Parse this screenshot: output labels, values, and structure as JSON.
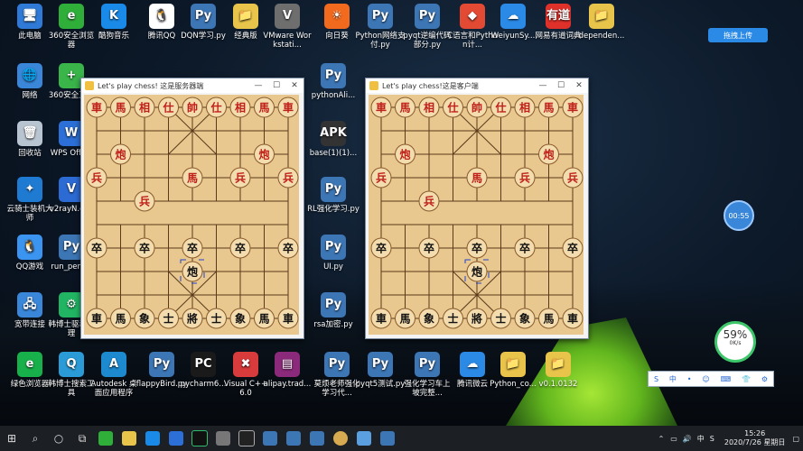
{
  "desktop_icons": [
    {
      "label": "此电脑",
      "color": "#2e7ad6",
      "glyph": "🖥"
    },
    {
      "label": "360安全浏览器",
      "color": "#2fae3a",
      "glyph": "e"
    },
    {
      "label": "酷狗音乐",
      "color": "#1a8ae8",
      "glyph": "K"
    },
    {
      "label": "腾讯QQ",
      "color": "#ffffff",
      "glyph": "🐧"
    },
    {
      "label": "DQN学习.py",
      "color": "#3d76b5",
      "glyph": "Py"
    },
    {
      "label": "经典版",
      "color": "#e8c44a",
      "glyph": "📁"
    },
    {
      "label": "VMware Workstati...",
      "color": "#6e6e6e",
      "glyph": "V"
    },
    {
      "label": "向日葵",
      "color": "#f26a1e",
      "glyph": "☀"
    },
    {
      "label": "Python网络支付.py",
      "color": "#3d76b5",
      "glyph": "Py"
    },
    {
      "label": "pyqt逆编代码部分.py",
      "color": "#3d76b5",
      "glyph": "Py"
    },
    {
      "label": "C语言和Python计...",
      "color": "#e24a34",
      "glyph": "◆"
    },
    {
      "label": "WeiyunSy...",
      "color": "#2a8ae6",
      "glyph": "☁"
    },
    {
      "label": "网易有道词典",
      "color": "#e0302a",
      "glyph": "有道"
    },
    {
      "label": "dependen...",
      "color": "#e8c44a",
      "glyph": "📁"
    },
    {
      "label": "网络",
      "color": "#3a86d8",
      "glyph": "🌐"
    },
    {
      "label": "360安全卫士",
      "color": "#39b54a",
      "glyph": "+"
    },
    {
      "label": "回收站",
      "color": "#b8c4d0",
      "glyph": "🗑"
    },
    {
      "label": "WPS Office",
      "color": "#2c6fd6",
      "glyph": "W"
    },
    {
      "label": "云骑士装机大师",
      "color": "#1f7ad2",
      "glyph": "✦"
    },
    {
      "label": "v2rayN.exe",
      "color": "#2d6bd4",
      "glyph": "V"
    },
    {
      "label": "QQ游戏",
      "color": "#3b95f0",
      "glyph": "🐧"
    },
    {
      "label": "run_pendu",
      "color": "#3d76b5",
      "glyph": "Py"
    },
    {
      "label": "宽带连接",
      "color": "#3a86d8",
      "glyph": "🖧"
    },
    {
      "label": "韩博士驱动助理",
      "color": "#21b563",
      "glyph": "⚙"
    },
    {
      "label": "绿色浏览器",
      "color": "#18b04a",
      "glyph": "e"
    },
    {
      "label": "韩博士搜索工具",
      "color": "#2a9bd6",
      "glyph": "Q"
    },
    {
      "label": "Autodesk 桌面应用程序",
      "color": "#1d8ad0",
      "glyph": "A"
    },
    {
      "label": "flappyBird.py",
      "color": "#3d76b5",
      "glyph": "Py"
    },
    {
      "label": "pycharm6...",
      "color": "#1a1a1a",
      "glyph": "PC"
    },
    {
      "label": "Visual C++ 6.0",
      "color": "#d83b3b",
      "glyph": "✖"
    },
    {
      "label": "alipay.trad...",
      "color": "#8b2a7a",
      "glyph": "▤"
    },
    {
      "label": "莫烦老师强化学习代...",
      "color": "#3d76b5",
      "glyph": "Py"
    },
    {
      "label": "pyqt5测试.py",
      "color": "#3d76b5",
      "glyph": "Py"
    },
    {
      "label": "强化学习车上坡完整...",
      "color": "#3d76b5",
      "glyph": "Py"
    },
    {
      "label": "腾讯微云",
      "color": "#2a8ae6",
      "glyph": "☁"
    },
    {
      "label": "Python_co...",
      "color": "#e8c44a",
      "glyph": "📁"
    },
    {
      "label": "v0.1.0132",
      "color": "#e8c44a",
      "glyph": "📁"
    },
    {
      "label": "pythonAli...",
      "color": "#3d76b5",
      "glyph": "Py"
    },
    {
      "label": "base(1)(1)...",
      "color": "#333333",
      "glyph": "APK"
    },
    {
      "label": "RL强化学习.py",
      "color": "#3d76b5",
      "glyph": "Py"
    },
    {
      "label": "UI.py",
      "color": "#3d76b5",
      "glyph": "Py"
    },
    {
      "label": "rsa加密.py",
      "color": "#3d76b5",
      "glyph": "Py"
    }
  ],
  "server_window": {
    "title": "Let's play chess! 这是服务器端",
    "min": "—",
    "max": "☐",
    "close": "✕"
  },
  "client_window": {
    "title": "Let's play chess!这是客户端",
    "min": "—",
    "max": "☐",
    "close": "✕"
  },
  "pieces_top": [
    "車",
    "馬",
    "相",
    "仕",
    "帥",
    "仕",
    "相",
    "馬",
    "車"
  ],
  "pieces_top_extra": [
    "炮",
    "炮",
    "兵",
    "馬",
    "兵",
    "兵",
    "兵"
  ],
  "pieces_bottom": [
    "車",
    "馬",
    "象",
    "士",
    "將",
    "士",
    "象",
    "馬",
    "車"
  ],
  "pieces_bottom_extra": [
    "卒",
    "卒",
    "卒",
    "卒",
    "卒",
    "炮"
  ],
  "float_button": "拖拽上传",
  "timer": "00:55",
  "netmon": {
    "percent": "59%",
    "speed": "0K/s"
  },
  "ime": [
    "S",
    "中",
    "•",
    "☺",
    "⌨",
    "👕",
    "⚙"
  ],
  "tray": {
    "lang": "中",
    "clock_time": "15:26",
    "clock_date": "2020/7/26 星期日"
  }
}
